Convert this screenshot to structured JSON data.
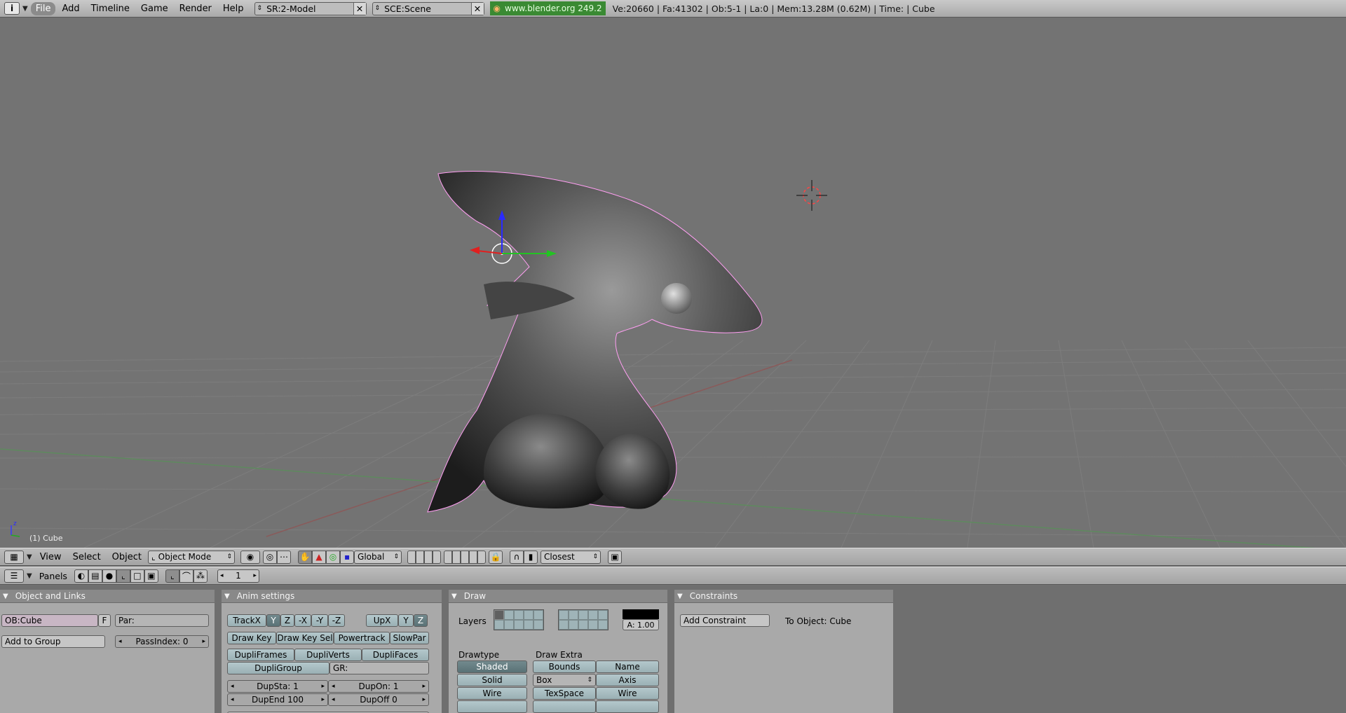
{
  "topbar": {
    "info_icon": "info-icon",
    "menus": [
      "File",
      "Add",
      "Timeline",
      "Game",
      "Render",
      "Help"
    ],
    "screen_field": "SR:2-Model",
    "scene_field": "SCE:Scene",
    "url": "www.blender.org 249.2",
    "stats": "Ve:20660 | Fa:41302 | Ob:5-1 | La:0  | Mem:13.28M (0.62M)  | Time: | Cube"
  },
  "viewport": {
    "object_label": "(1) Cube",
    "axis_z": "z",
    "background_color": "#737373",
    "selection_outline_color": "#ff9ff2"
  },
  "view3d_header": {
    "menus": [
      "View",
      "Select",
      "Object"
    ],
    "mode": "Object Mode",
    "orientation": "Global",
    "snap": "Closest"
  },
  "buttons_header": {
    "panels_label": "Panels",
    "frame": "1"
  },
  "object_links": {
    "title": "Object and Links",
    "ob_field": "OB:Cube",
    "f_button": "F",
    "par_field": "Par:",
    "add_group": "Add to Group",
    "pass_index": "PassIndex: 0"
  },
  "anim_settings": {
    "title": "Anim settings",
    "track": [
      "TrackX",
      "Y",
      "Z",
      "-X",
      "-Y",
      "-Z"
    ],
    "up": [
      "UpX",
      "Y",
      "Z"
    ],
    "row2": [
      "Draw Key",
      "Draw Key Sel",
      "Powertrack",
      "SlowPar"
    ],
    "row3": [
      "DupliFrames",
      "DupliVerts",
      "DupliFaces"
    ],
    "dupligroup": "DupliGroup",
    "gr": "GR:",
    "dupsta": "DupSta: 1",
    "dupon": "DupOn: 1",
    "dupend": "DupEnd 100",
    "dupoff": "DupOff 0"
  },
  "draw": {
    "title": "Draw",
    "layers_label": "Layers",
    "alpha": "A: 1.00",
    "drawtype_label": "Drawtype",
    "draw_extra_label": "Draw Extra",
    "drawtypes": [
      "Shaded",
      "Solid",
      "Wire"
    ],
    "bounds": "Bounds",
    "name": "Name",
    "box": "Box",
    "axis": "Axis",
    "texspace": "TexSpace",
    "wire": "Wire"
  },
  "constraints": {
    "title": "Constraints",
    "add": "Add Constraint",
    "to_object": "To Object: Cube"
  }
}
